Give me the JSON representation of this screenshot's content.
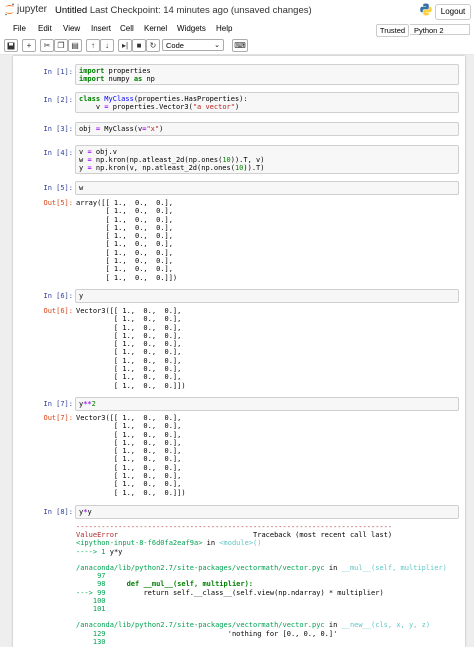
{
  "header": {
    "logo_text": "jupyter",
    "notebook_name": "Untitled",
    "checkpoint": "Last Checkpoint: 14 minutes ago (unsaved changes)",
    "logout": "Logout"
  },
  "menubar": {
    "items": [
      "File",
      "Edit",
      "View",
      "Insert",
      "Cell",
      "Kernel",
      "Widgets",
      "Help"
    ],
    "trusted": "Trusted",
    "kernel": "Python 2"
  },
  "toolbar": {
    "cell_type": "Code"
  },
  "cells": [
    {
      "prompt": "In [1]:",
      "lines": [
        "import properties",
        "import numpy as np"
      ]
    },
    {
      "prompt": "In [2]:",
      "lines": [
        "class MyClass(properties.HasProperties):",
        "    v = properties.Vector3(\"a vector\")"
      ]
    },
    {
      "prompt": "In [3]:",
      "lines": [
        "obj = MyClass(v=\"x\")"
      ]
    },
    {
      "prompt": "In [4]:",
      "lines": [
        "v = obj.v",
        "w = np.kron(np.atleast_2d(np.ones(10)).T, v)",
        "y = np.kron(v, np.atleast_2d(np.ones(10)).T)"
      ]
    },
    {
      "prompt": "In [5]:",
      "lines": [
        "w"
      ]
    },
    {
      "prompt": "In [6]:",
      "lines": [
        "y"
      ]
    },
    {
      "prompt": "In [7]:",
      "lines": [
        "y**2"
      ]
    },
    {
      "prompt": "In [8]:",
      "lines": [
        "y*y"
      ]
    }
  ],
  "outputs": [
    {
      "prompt": "Out[5]:",
      "text": "array([[ 1.,  0.,  0.],\n       [ 1.,  0.,  0.],\n       [ 1.,  0.,  0.],\n       [ 1.,  0.,  0.],\n       [ 1.,  0.,  0.],\n       [ 1.,  0.,  0.],\n       [ 1.,  0.,  0.],\n       [ 1.,  0.,  0.],\n       [ 1.,  0.,  0.],\n       [ 1.,  0.,  0.]])"
    },
    {
      "prompt": "Out[6]:",
      "text": "Vector3([[ 1.,  0.,  0.],\n         [ 1.,  0.,  0.],\n         [ 1.,  0.,  0.],\n         [ 1.,  0.,  0.],\n         [ 1.,  0.,  0.],\n         [ 1.,  0.,  0.],\n         [ 1.,  0.,  0.],\n         [ 1.,  0.,  0.],\n         [ 1.,  0.,  0.],\n         [ 1.,  0.,  0.]])"
    },
    {
      "prompt": "Out[7]:",
      "text": "Vector3([[ 1.,  0.,  0.],\n         [ 1.,  0.,  0.],\n         [ 1.,  0.,  0.],\n         [ 1.,  0.,  0.],\n         [ 1.,  0.,  0.],\n         [ 1.,  0.,  0.],\n         [ 1.,  0.,  0.],\n         [ 1.,  0.,  0.],\n         [ 1.,  0.,  0.],\n         [ 1.,  0.,  0.]])"
    }
  ],
  "error": {
    "rule": "---------------------------------------------------------------------------",
    "name": "ValueError",
    "traceback_label": "Traceback (most recent call last)",
    "ipython_input": "<ipython-input-8-f6d0fa2eaf9a>",
    "in_word": "in",
    "module": "<module>()",
    "arrow1_line": "----> 1",
    "arrow1_code": "y*y",
    "file1": "/anaconda/lib/python2.7/site-packages/vectormath/vector.pyc",
    "func1": "__mul__(self, multiplier)",
    "line97": "     97",
    "line98": "     98",
    "code98": "    def __mul__(self, multiplier):",
    "arrow99": "---> 99",
    "code99": "        return self.__class__(self.view(np.ndarray) * multiplier)",
    "line100": "    100",
    "line101": "    101",
    "file2": "/anaconda/lib/python2.7/site-packages/vectormath/vector.pyc",
    "func2": "__new__(cls, x, y, z)",
    "line129": "    129",
    "code129": "                            'nothing for [0., 0., 0.]'",
    "line130": "    130"
  },
  "colors": {
    "in_prompt": "#303f9f",
    "out_prompt": "#d84315",
    "keyword": "#008000",
    "class_name": "#0000ff",
    "string": "#ba2121"
  }
}
